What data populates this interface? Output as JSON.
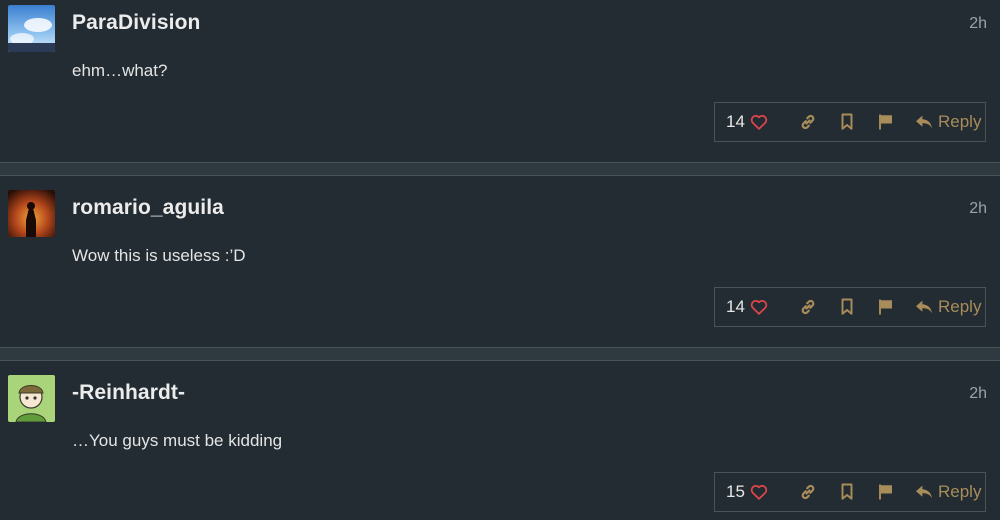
{
  "posts": [
    {
      "username": "ParaDivision",
      "time": "2h",
      "content": "ehm…what?",
      "likes": "14",
      "reply_label": "Reply",
      "avatar": "sky-clouds-avatar"
    },
    {
      "username": "romario_aguila",
      "time": "2h",
      "content": "Wow this is useless :’D",
      "likes": "14",
      "reply_label": "Reply",
      "avatar": "fire-silhouette-avatar"
    },
    {
      "username": "-Reinhardt-",
      "time": "2h",
      "content": "…You guys must be kidding",
      "likes": "15",
      "reply_label": "Reply",
      "avatar": "anime-character-avatar"
    }
  ],
  "colors": {
    "background": "#232c32",
    "heart": "#e0454c",
    "action_icon": "#a88c5a",
    "username": "#ececec",
    "timestamp": "#9aa3a8"
  },
  "icons": {
    "like": "heart-icon",
    "copy_link": "link-icon",
    "bookmark": "bookmark-icon",
    "flag": "flag-icon",
    "reply": "reply-arrow-icon"
  }
}
